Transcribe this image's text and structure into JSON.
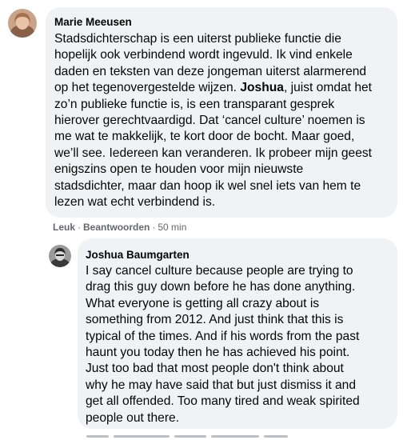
{
  "comments": [
    {
      "author": "Marie Meeusen",
      "text_before_mention": "Stadsdichterschap is een uiterst publieke functie die\nhopelijk ook verbindend wordt ingevuld. Ik vind enkele\ndaden en teksten van deze jongeman uiterst alarmerend\nop het tegenovergestelde wijzen. ",
      "mention": "Joshua",
      "text_after_mention": ", juist omdat het\nzo’n publieke functie is, is een transparant gesprek\nhierover gerechtvaardigd. Dat ‘cancel culture’ noemen is\nme wat te makkelijk, te kort door de bocht. Maar goed,\nwe’ll see. Iedereen kan veranderen. Ik probeer mijn geest\nenigszins open te houden voor mijn nieuwste\nstadsdichter, maar dan hoop ik wel snel iets van hem te\nlezen wat echt verbindend is.",
      "actions": {
        "like": "Leuk",
        "separator": "·",
        "reply": "Beantwoorden",
        "time": "50 min"
      }
    },
    {
      "author": "Joshua Baumgarten",
      "text": "I say cancel culture because people are trying to\ndrag this guy down before he has done anything.\nWhat everyone is getting all crazy about is\nsomething from 2012. And just think that this is\ntypical of the times. And if his words from the past\nhaunt you today then he has achieved his point.\nJust too bad that most people don't think about\nwhy he may have said that but just dismiss it and\nget all offended. Too many tired and weak spirited\npeople out there."
    }
  ]
}
